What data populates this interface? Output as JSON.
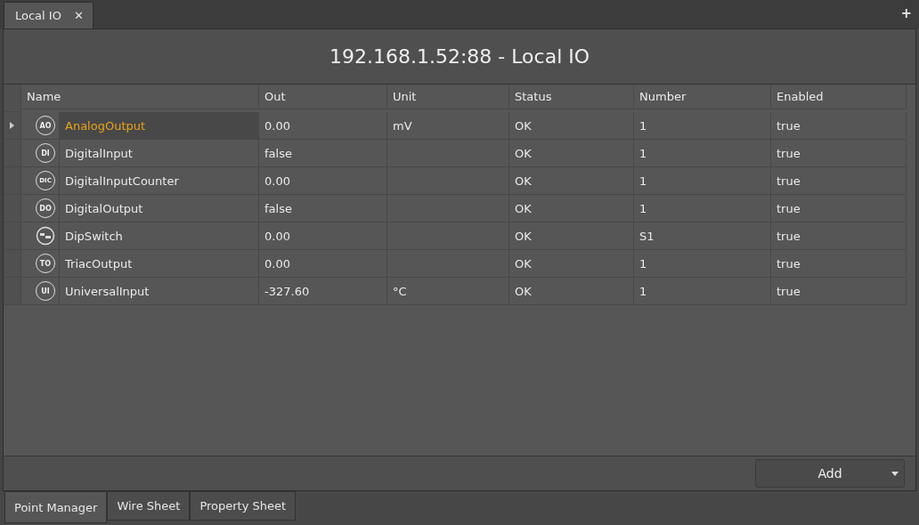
{
  "top_tabs": [
    {
      "label": "Local IO",
      "selected": true,
      "close": "✕"
    }
  ],
  "add_tab": "+",
  "title": "192.168.1.52:88 - Local IO",
  "table": {
    "columns": [
      "Name",
      "Out",
      "Unit",
      "Status",
      "Number",
      "Enabled"
    ],
    "rows": [
      {
        "selected": true,
        "badge": "AO",
        "cells": [
          "AnalogOutput",
          "0.00",
          "mV",
          "OK",
          "1",
          "true"
        ]
      },
      {
        "selected": false,
        "badge": "DI",
        "cells": [
          "DigitalInput",
          "false",
          "",
          "OK",
          "1",
          "true"
        ]
      },
      {
        "selected": false,
        "badge": "DIC",
        "cells": [
          "DigitalInputCounter",
          "0.00",
          "",
          "OK",
          "1",
          "true"
        ]
      },
      {
        "selected": false,
        "badge": "DO",
        "cells": [
          "DigitalOutput",
          "false",
          "",
          "OK",
          "1",
          "true"
        ]
      },
      {
        "selected": false,
        "kind": "switch",
        "cells": [
          "DipSwitch",
          "0.00",
          "",
          "OK",
          "S1",
          "true"
        ]
      },
      {
        "selected": false,
        "badge": "TO",
        "cells": [
          "TriacOutput",
          "0.00",
          "",
          "OK",
          "1",
          "true"
        ]
      },
      {
        "selected": false,
        "badge": "UI",
        "cells": [
          "UniversalInput",
          "-327.60",
          "°C",
          "OK",
          "1",
          "true"
        ]
      }
    ]
  },
  "add_button": "Add",
  "bottom_tabs": [
    {
      "label": "Point Manager",
      "selected": true
    },
    {
      "label": "Wire Sheet",
      "selected": false
    },
    {
      "label": "Property Sheet",
      "selected": false
    }
  ]
}
